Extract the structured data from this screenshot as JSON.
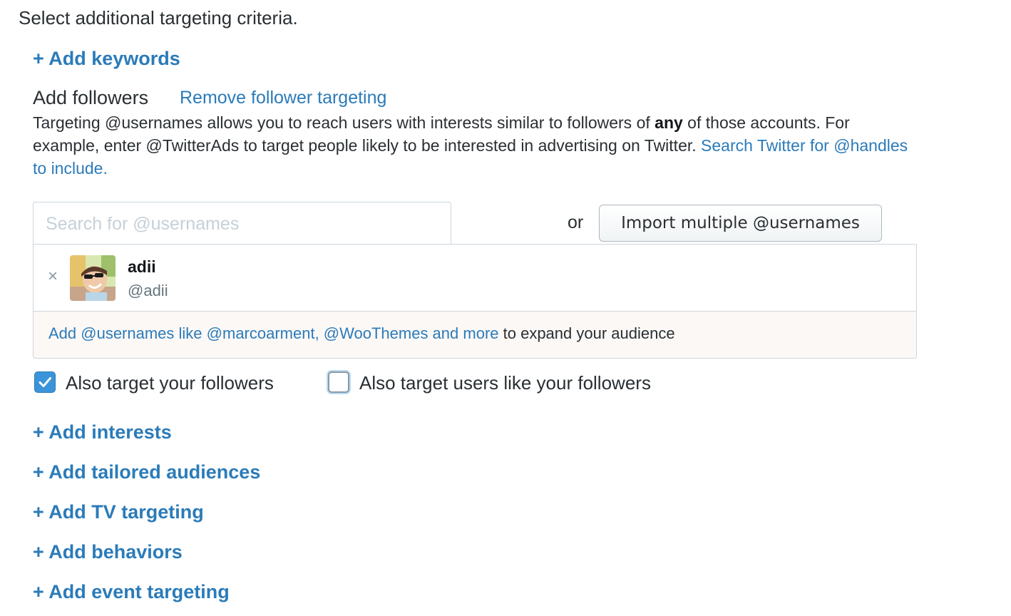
{
  "heading": "Select additional targeting criteria.",
  "add_keywords": "+ Add keywords",
  "followers": {
    "title": "Add followers",
    "remove_link": "Remove follower targeting",
    "desc_part1": "Targeting @usernames allows you to reach users with interests similar to followers of ",
    "desc_bold": "any",
    "desc_part2": " of those accounts. For example, enter @TwitterAds to target people likely to be interested in advertising on Twitter. ",
    "desc_link": "Search Twitter for @handles to include.",
    "search_placeholder": "Search for @usernames",
    "or": "or",
    "import_button": "Import multiple @usernames",
    "selected_user": {
      "name": "adii",
      "handle": "@adii",
      "remove_icon": "×"
    },
    "suggestion_link": "Add @usernames like @marcoarment, @WooThemes and more",
    "suggestion_text": " to expand your audience",
    "checkbox_followers": {
      "label": "Also target your followers",
      "checked": true
    },
    "checkbox_similar": {
      "label": "Also target users like your followers",
      "checked": false
    }
  },
  "add_links": {
    "interests": "+ Add interests",
    "tailored": "+ Add tailored audiences",
    "tv": "+ Add TV targeting",
    "behaviors": "+ Add behaviors",
    "events": "+ Add event targeting"
  },
  "colors": {
    "link": "#2b7bb9",
    "text": "#292f33",
    "checkbox_checked": "#3b94d9",
    "suggest_bg": "#fcf8f6"
  }
}
